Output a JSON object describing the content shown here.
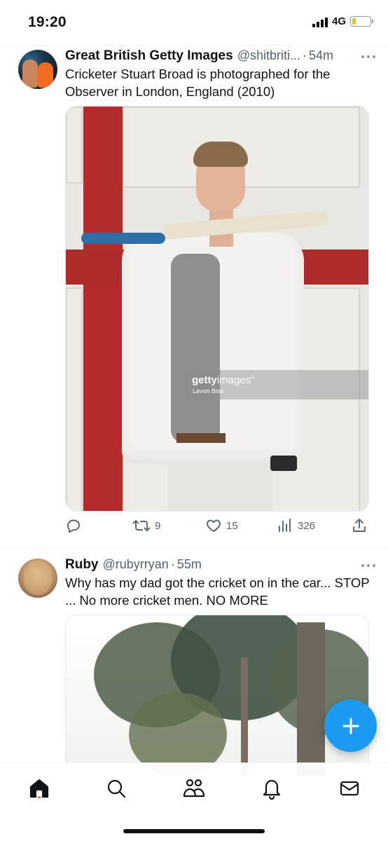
{
  "status_bar": {
    "time": "19:20",
    "network": "4G",
    "icons": [
      "signal-bars-icon",
      "battery-icon"
    ]
  },
  "tweets": [
    {
      "name": "Great British Getty Images",
      "handle": "@shitbriti...",
      "dot": "·",
      "time": "54m",
      "text": "Cricketer Stuart Broad is photographed for the Observer in London, England (2010)",
      "media": {
        "watermark_brand_bold": "getty",
        "watermark_brand_light": "images",
        "watermark_mark": "®",
        "watermark_credit": "Levon Biss"
      },
      "replies": "",
      "retweets": "9",
      "likes": "15",
      "views": "326"
    },
    {
      "name": "Ruby",
      "handle": "@rubyrryan",
      "dot": "·",
      "time": "55m",
      "text": "Why has my dad got the cricket on in the car... STOP ... No more cricket men. NO MORE"
    }
  ],
  "fab": {
    "label": "+",
    "color": "#1d9bf0"
  },
  "bottom_nav": [
    "home-icon",
    "search-icon",
    "communities-icon",
    "notifications-icon",
    "messages-icon"
  ],
  "colors": {
    "accent": "#1d9bf0",
    "secondary_text": "#536471",
    "primary_text": "#0f1419"
  }
}
